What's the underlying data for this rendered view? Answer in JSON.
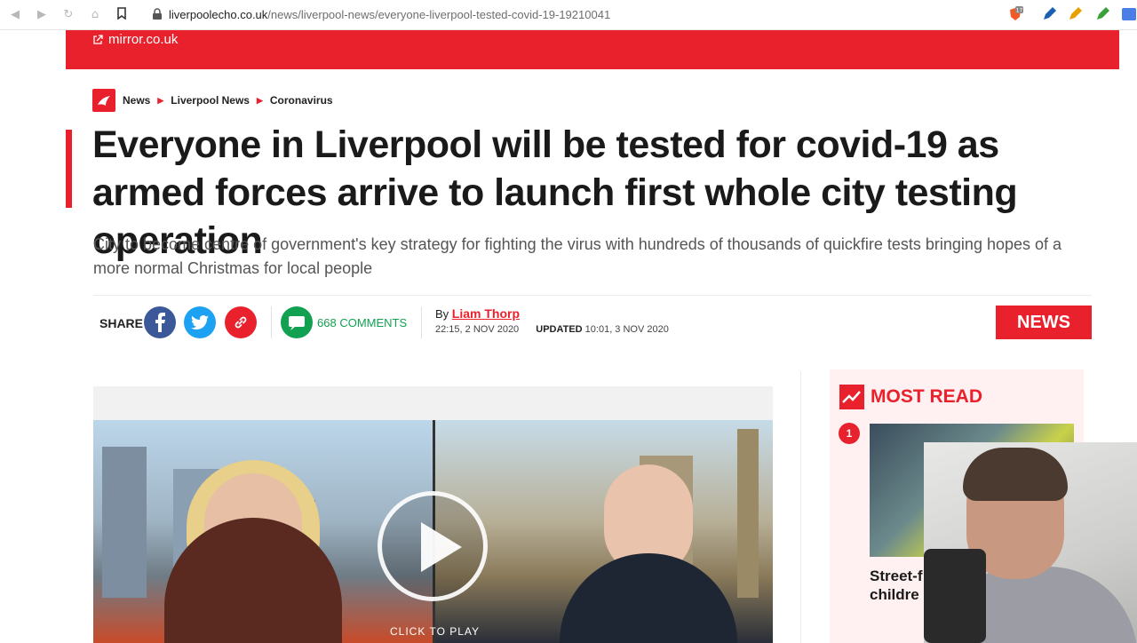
{
  "browser": {
    "url_domain": "liverpoolecho.co.uk",
    "url_path": "/news/liverpool-news/everyone-liverpool-tested-covid-19-19210041",
    "brave_badge": "17"
  },
  "banner": {
    "link_text": "mirror.co.uk"
  },
  "breadcrumb": [
    "News",
    "Liverpool News",
    "Coronavirus"
  ],
  "article": {
    "headline": "Everyone in Liverpool will be tested for covid-19 as armed forces arrive to launch first whole city testing operation",
    "standfirst": "City to become centre of government's key strategy for fighting the virus with hundreds of thousands of quickfire tests bringing hopes of a more normal Christmas for local people"
  },
  "share": {
    "label": "SHARE",
    "comments_count": "668",
    "comments_label": "COMMENTS"
  },
  "byline": {
    "by": "By",
    "author": "Liam Thorp",
    "published": "22:15, 2 NOV 2020",
    "updated_label": "UPDATED",
    "updated": "10:01, 3 NOV 2020"
  },
  "section_badge": "NEWS",
  "video": {
    "cta": "CLICK TO PLAY"
  },
  "most_read": {
    "title": "MOST READ",
    "items": [
      {
        "rank": "1",
        "text": "Street-f accider lockdov childre"
      }
    ]
  },
  "colors": {
    "brand_red": "#e8212c",
    "facebook": "#3b5998",
    "twitter": "#1da1f2",
    "comments_green": "#12a150"
  }
}
